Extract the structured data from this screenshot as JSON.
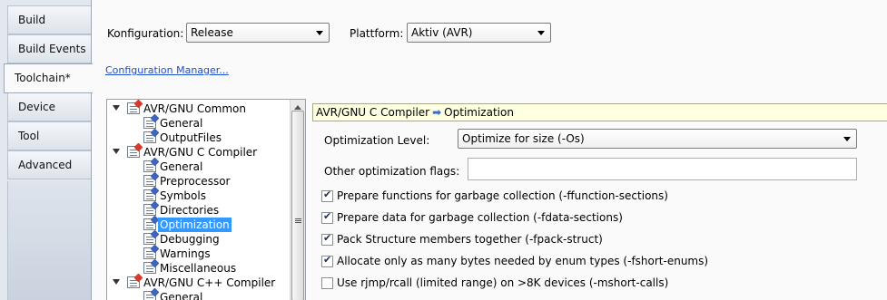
{
  "tabs": [
    {
      "label": "Build",
      "active": false
    },
    {
      "label": "Build Events",
      "active": false
    },
    {
      "label": "Toolchain*",
      "active": true
    },
    {
      "label": "Device",
      "active": false
    },
    {
      "label": "Tool",
      "active": false
    },
    {
      "label": "Advanced",
      "active": false
    }
  ],
  "config": {
    "configuration_label": "Konfiguration:",
    "configuration_value": "Release",
    "platform_label": "Plattform:",
    "platform_value": "Aktiv (AVR)",
    "manager_link": "Configuration Manager..."
  },
  "tree": {
    "nodes": [
      {
        "label": "AVR/GNU Common",
        "level": 0,
        "expanded": true
      },
      {
        "label": "General",
        "level": 1
      },
      {
        "label": "OutputFiles",
        "level": 1
      },
      {
        "label": "AVR/GNU C Compiler",
        "level": 0,
        "expanded": true
      },
      {
        "label": "General",
        "level": 1
      },
      {
        "label": "Preprocessor",
        "level": 1
      },
      {
        "label": "Symbols",
        "level": 1
      },
      {
        "label": "Directories",
        "level": 1
      },
      {
        "label": "Optimization",
        "level": 1,
        "selected": true
      },
      {
        "label": "Debugging",
        "level": 1
      },
      {
        "label": "Warnings",
        "level": 1
      },
      {
        "label": "Miscellaneous",
        "level": 1
      },
      {
        "label": "AVR/GNU C++ Compiler",
        "level": 0,
        "expanded": true
      },
      {
        "label": "General",
        "level": 1
      }
    ]
  },
  "panel": {
    "breadcrumb_parent": "AVR/GNU C Compiler",
    "breadcrumb_arrow": "➡",
    "breadcrumb_current": "Optimization",
    "optimization_level_label": "Optimization Level:",
    "optimization_level_value": "Optimize for size (-Os)",
    "other_flags_label": "Other optimization flags:",
    "other_flags_value": "",
    "checkboxes": [
      {
        "label": "Prepare functions for garbage collection (-ffunction-sections)",
        "checked": true
      },
      {
        "label": "Prepare data for garbage collection (-fdata-sections)",
        "checked": true
      },
      {
        "label": "Pack Structure members together (-fpack-struct)",
        "checked": true
      },
      {
        "label": "Allocate only as many bytes needed by enum types (-fshort-enums)",
        "checked": true
      },
      {
        "label": "Use rjmp/rcall (limited range) on >8K devices (-mshort-calls)",
        "checked": false
      }
    ]
  },
  "colors": {
    "selection": "#3399ff",
    "breadcrumb_bg": "#ffffe1",
    "link": "#1d4fd0"
  }
}
